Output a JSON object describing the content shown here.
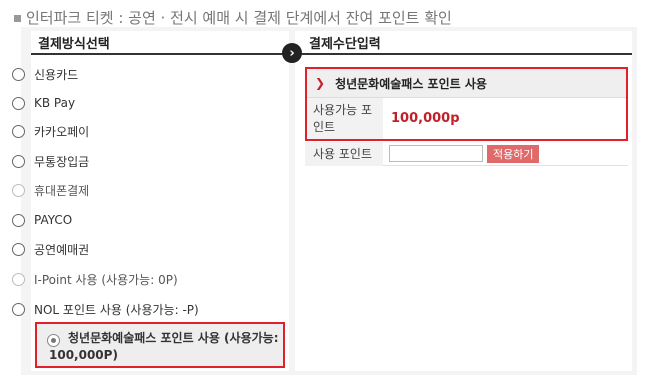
{
  "caption": "인터파크 티켓 : 공연 · 전시 예매 시 결제 단계에서 잔여 포인트 확인",
  "left_panel": {
    "title": "결제방식선택",
    "methods": [
      {
        "label": "신용카드"
      },
      {
        "label": "KB Pay"
      },
      {
        "label": "카카오페이"
      },
      {
        "label": "무통장입금"
      },
      {
        "label": "휴대폰결제"
      },
      {
        "label": "PAYCO"
      },
      {
        "label": "공연예매권"
      },
      {
        "label": "I-Point 사용 (사용가능: 0P)"
      },
      {
        "label": "NOL 포인트 사용 (사용가능: -P)"
      }
    ],
    "selected_method": "청년문화예술패스 포인트 사용 (사용가능: 100,000P)"
  },
  "arrow": "›",
  "right_panel": {
    "title": "결제수단입력",
    "pass_title": "청년문화예술패스 포인트 사용",
    "available_label": "사용가능 포인트",
    "available_value": "100,000p",
    "use_label": "사용 포인트",
    "use_input_value": "",
    "apply_button": "적용하기"
  },
  "colors": {
    "highlight_border": "#e0202a",
    "point_value": "#c0202a",
    "apply_button_bg": "#e06a6a"
  }
}
